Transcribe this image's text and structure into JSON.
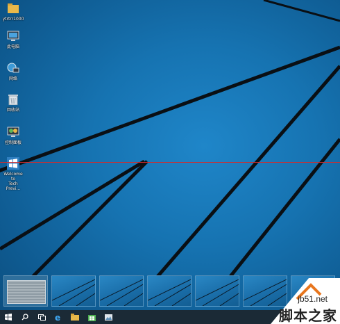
{
  "desktop_icons": [
    {
      "label": "ytrtrr1000",
      "icon": "folder-icon"
    },
    {
      "label": "此电脑",
      "icon": "computer-icon"
    },
    {
      "label": "网络",
      "icon": "network-icon"
    },
    {
      "label": "回收站",
      "icon": "recycle-bin-icon"
    },
    {
      "label": "控制面板",
      "icon": "control-panel-icon"
    },
    {
      "label": "Welcome to\nTech Previ...",
      "icon": "windows-logo-icon"
    }
  ],
  "taskbar": {
    "buttons": [
      "start-icon",
      "search-icon",
      "task-view-icon",
      "ie-icon",
      "file-explorer-icon",
      "store-icon",
      "photos-icon"
    ]
  },
  "thumbnails": {
    "count": 7
  },
  "watermark": {
    "site": "jb51.net",
    "name": "脚本之家"
  },
  "colors": {
    "accent": "#1673b1",
    "taskbar": "#1b2a36",
    "guide_line": "#d42a2a"
  }
}
